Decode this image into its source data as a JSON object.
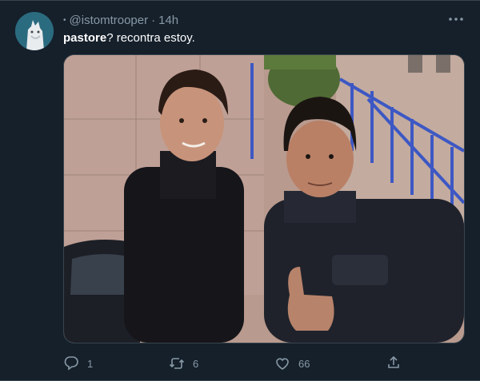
{
  "tweet": {
    "handle": "@istomtrooper",
    "time": "14h",
    "bold_text": "pastore",
    "text": "? recontra estoy."
  },
  "actions": {
    "reply_count": "1",
    "retweet_count": "6",
    "like_count": "66"
  },
  "colors": {
    "background": "#15202b",
    "muted": "#8899a6",
    "border": "#38444d"
  },
  "icons": [
    "avatar",
    "more-icon",
    "reply-icon",
    "retweet-icon",
    "like-icon",
    "share-icon"
  ]
}
